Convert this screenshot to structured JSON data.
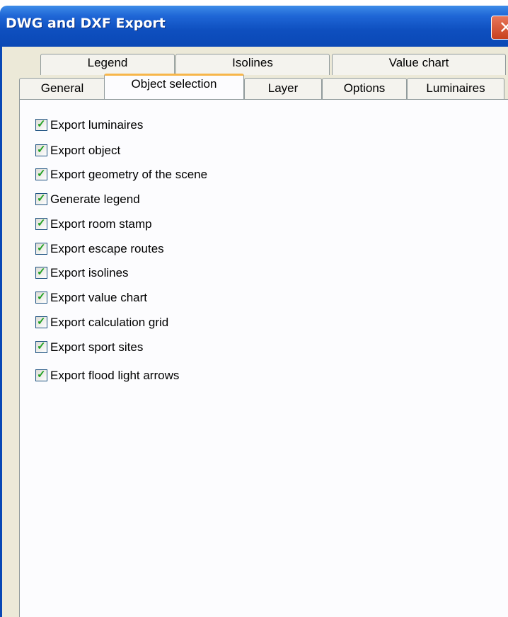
{
  "window": {
    "title": "DWG and DXF Export",
    "close_glyph": "✕"
  },
  "tabs": {
    "row_back": [
      {
        "label": "Legend"
      },
      {
        "label": "Isolines"
      },
      {
        "label": "Value chart"
      }
    ],
    "row_front": [
      {
        "label": "General",
        "active": false
      },
      {
        "label": "Object selection",
        "active": true
      },
      {
        "label": "Layer",
        "active": false
      },
      {
        "label": "Options",
        "active": false
      },
      {
        "label": "Luminaires",
        "active": false
      }
    ]
  },
  "options": [
    {
      "label": "Export luminaires",
      "checked": true
    },
    {
      "label": "Export object",
      "checked": true
    },
    {
      "label": "Export geometry of the scene",
      "checked": true
    },
    {
      "label": "Generate legend",
      "checked": true
    },
    {
      "label": "Export room stamp",
      "checked": true
    },
    {
      "label": "Export escape routes",
      "checked": true
    },
    {
      "label": "Export isolines",
      "checked": true
    },
    {
      "label": "Export value chart",
      "checked": true
    },
    {
      "label": "Export calculation grid",
      "checked": true
    },
    {
      "label": "Export sport sites",
      "checked": true
    },
    {
      "label": "Export flood light arrows",
      "checked": true
    }
  ],
  "colors": {
    "titlebar": "#0a48b5",
    "check": "#21a121",
    "active_tab_accent": "#f7b64a"
  },
  "icons": {
    "checkmark": "check-icon",
    "close": "close-icon"
  }
}
